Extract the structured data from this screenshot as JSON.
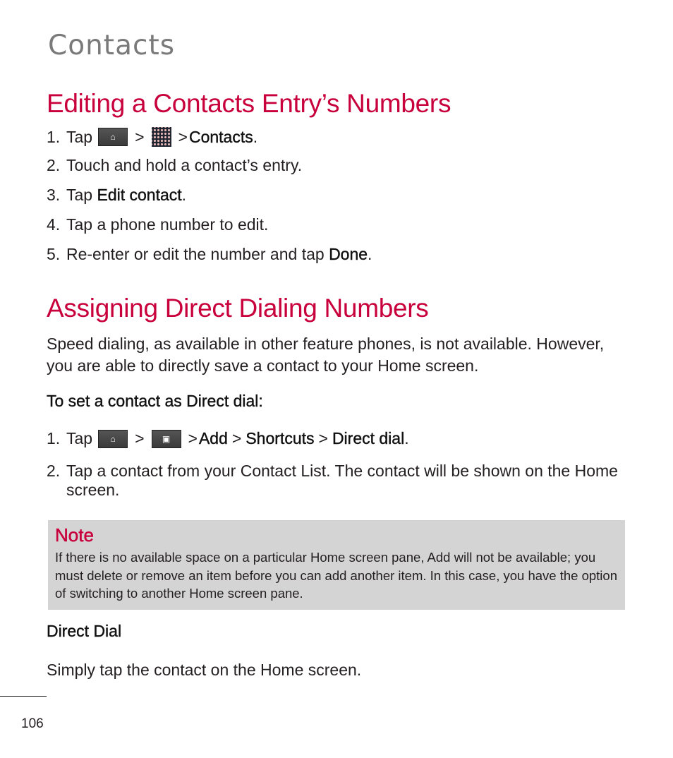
{
  "section_title": "Contacts",
  "sections": [
    {
      "heading": "Editing a Contacts Entry’s Numbers",
      "steps": [
        {
          "num": "1.",
          "parts": {
            "tap": "Tap",
            "icon1": "home-icon",
            "sep1": ">",
            "icon2": "apps-grid-icon",
            "sep2": ">",
            "target": "Contacts",
            "end": "."
          }
        },
        {
          "num": "2.",
          "text": "Touch and hold a contact’s entry."
        },
        {
          "num": "3.",
          "pre": "Tap ",
          "bold": "Edit contact",
          "post": "."
        },
        {
          "num": "4.",
          "text": "Tap a phone number to edit."
        },
        {
          "num": "5.",
          "pre": "Re-enter or edit the number and tap ",
          "bold": "Done",
          "post": "."
        }
      ]
    },
    {
      "heading": "Assigning Direct Dialing Numbers",
      "intro": "Speed dialing, as available in other feature phones, is not available. However, you are able to directly save a contact to your Home screen.",
      "subheading": "To set a contact as Direct dial:",
      "steps": [
        {
          "num": "1.",
          "parts": {
            "tap": "Tap",
            "icon1": "home-icon",
            "sep1": ">",
            "icon2": "menu-icon",
            "sep2": ">",
            "add": "Add",
            "sep3": ">",
            "shortcuts": "Shortcuts",
            "sep4": ">",
            "direct": "Direct dial",
            "end": "."
          }
        },
        {
          "num": "2.",
          "text": "Tap a contact from your Contact List. The contact will be shown on the Home screen."
        }
      ]
    }
  ],
  "note": {
    "title": "Note",
    "body": "If there is no available space on a particular Home screen pane, Add will not be available; you must delete or remove an item before you can add another item. In this case, you have the option of switching to another Home screen pane."
  },
  "direct_dial": {
    "heading": "Direct Dial",
    "text": "Simply tap the contact on the Home screen."
  },
  "page_number": "106",
  "colors": {
    "accent": "#c8003c",
    "note_bg": "#d4d4d4",
    "section_title": "#7a7a7a"
  }
}
